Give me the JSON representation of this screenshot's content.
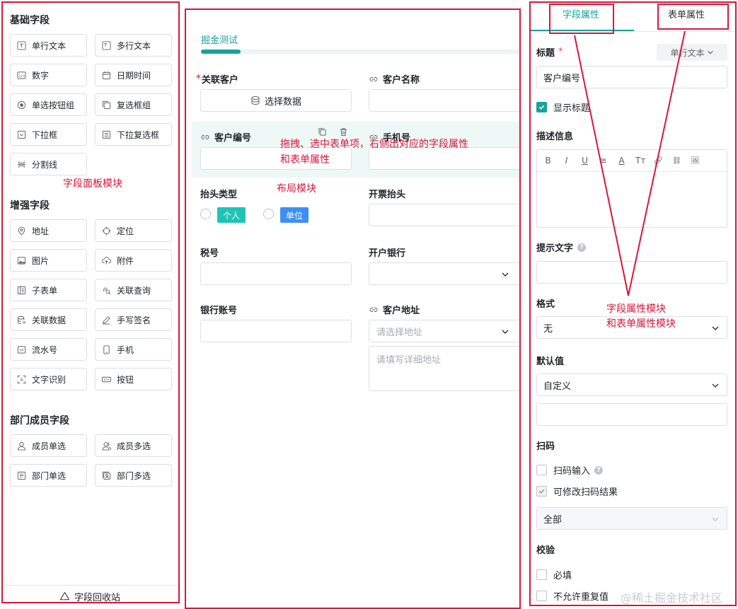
{
  "left": {
    "basic_title": "基础字段",
    "basic_fields": [
      {
        "label": "单行文本",
        "icon": "single-line-text-icon"
      },
      {
        "label": "多行文本",
        "icon": "multi-line-text-icon"
      },
      {
        "label": "数字",
        "icon": "number-icon"
      },
      {
        "label": "日期时间",
        "icon": "calendar-icon"
      },
      {
        "label": "单选按钮组",
        "icon": "radio-icon"
      },
      {
        "label": "复选框组",
        "icon": "checkbox-group-icon"
      },
      {
        "label": "下拉框",
        "icon": "dropdown-icon"
      },
      {
        "label": "下拉复选框",
        "icon": "dropdown-checkbox-icon"
      },
      {
        "label": "分割线",
        "icon": "divider-icon"
      }
    ],
    "enhanced_title": "增强字段",
    "enhanced_fields": [
      {
        "label": "地址",
        "icon": "location-pin-icon"
      },
      {
        "label": "定位",
        "icon": "crosshair-icon"
      },
      {
        "label": "图片",
        "icon": "image-icon"
      },
      {
        "label": "附件",
        "icon": "upload-cloud-icon"
      },
      {
        "label": "子表单",
        "icon": "subform-icon"
      },
      {
        "label": "关联查询",
        "icon": "link-search-icon"
      },
      {
        "label": "关联数据",
        "icon": "database-icon"
      },
      {
        "label": "手写签名",
        "icon": "pen-icon"
      },
      {
        "label": "流水号",
        "icon": "serial-number-icon"
      },
      {
        "label": "手机",
        "icon": "phone-icon"
      },
      {
        "label": "文字识别",
        "icon": "ocr-icon"
      },
      {
        "label": "按钮",
        "icon": "button-icon"
      }
    ],
    "dept_title": "部门成员字段",
    "dept_fields": [
      {
        "label": "成员单选",
        "icon": "user-icon"
      },
      {
        "label": "成员多选",
        "icon": "users-icon"
      },
      {
        "label": "部门单选",
        "icon": "department-icon"
      },
      {
        "label": "部门多选",
        "icon": "departments-icon"
      }
    ],
    "trash_label": "字段回收站"
  },
  "middle": {
    "tab": "掘金测试",
    "fields": {
      "related_customer": {
        "label": "关联客户",
        "button": "选择数据"
      },
      "customer_name": {
        "label": "客户名称"
      },
      "customer_no": {
        "label": "客户编号"
      },
      "phone": {
        "label": "手机号"
      },
      "header_type": {
        "label": "抬头类型",
        "options": [
          "个人",
          "单位"
        ]
      },
      "invoice_header": {
        "label": "开票抬头"
      },
      "tax_no": {
        "label": "税号"
      },
      "bank": {
        "label": "开户银行"
      },
      "bank_account": {
        "label": "银行账号"
      },
      "address": {
        "label": "客户地址",
        "placeholder": "请选择地址",
        "detail_placeholder": "请填写详细地址"
      }
    }
  },
  "right": {
    "tabs": [
      "字段属性",
      "表单属性"
    ],
    "title_label": "标题",
    "type_pill": "单行文本",
    "title_value": "客户编号",
    "show_title": "显示标题",
    "desc_label": "描述信息",
    "editor_tools": [
      "B",
      "I",
      "U",
      "≡",
      "A",
      "Tт",
      "🔗",
      "⛓",
      "🖼"
    ],
    "hint_label": "提示文字",
    "format_label": "格式",
    "format_value": "无",
    "default_label": "默认值",
    "default_value": "自定义",
    "scan_label": "扫码",
    "scan_input": "扫码输入",
    "scan_modify": "可修改扫码结果",
    "scan_scope": "全部",
    "validate_label": "校验",
    "required": "必填",
    "no_duplicate": "不允许重复值"
  },
  "annotations": {
    "field_panel": "字段面板模块",
    "layout": "布局模块",
    "drag_hint": "拖拽、选中表单项，右侧出对应的字段属性\n和表单属性",
    "props_panel": "字段属性模块\n和表单属性模块"
  },
  "watermark": "@稀土掘金技术社区",
  "colors": {
    "accent": "#16a39b",
    "annotation": "#d9163a",
    "tag_personal": "#1fc4b8",
    "tag_unit": "#3e8ef7"
  }
}
